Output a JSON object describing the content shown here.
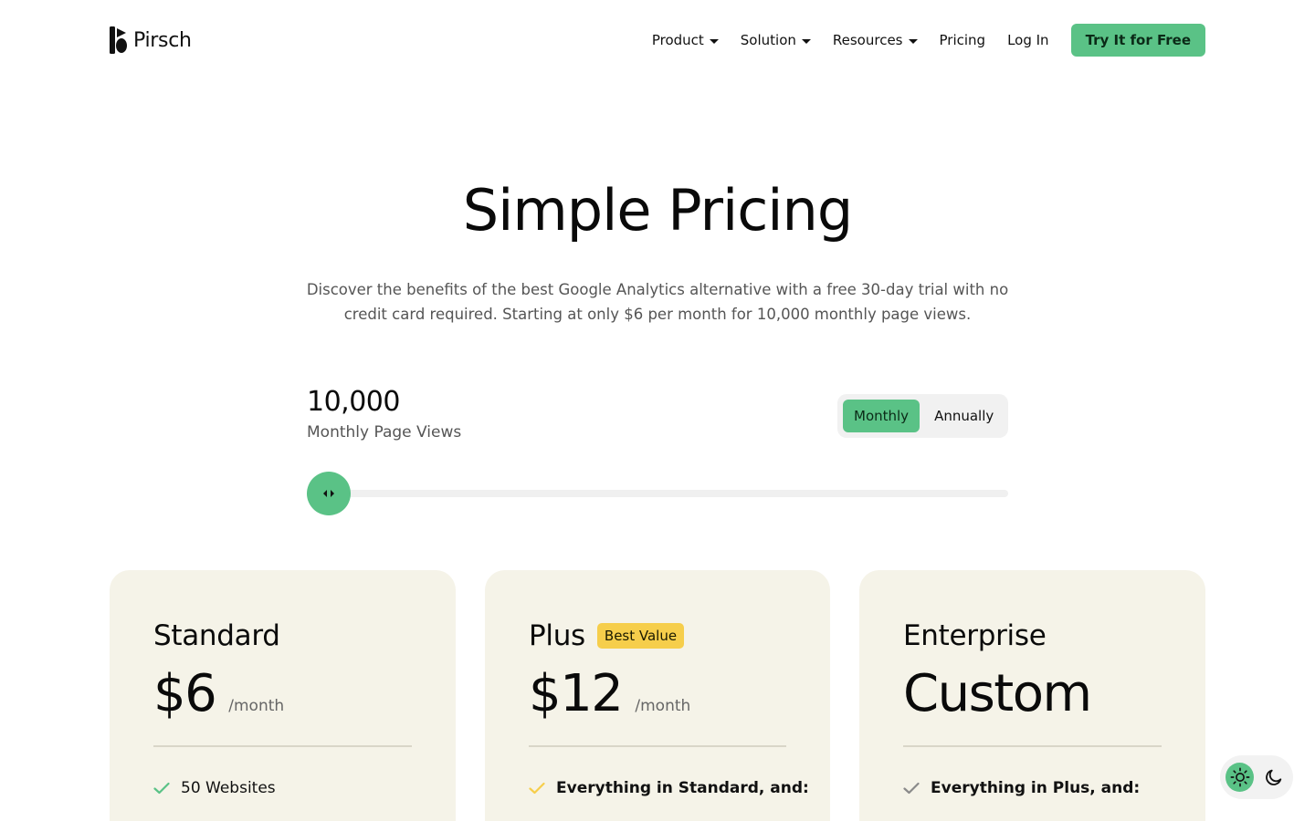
{
  "brand": {
    "name": "Pirsch",
    "accent": "#5ac286",
    "badge_color": "#f6ce4b",
    "card_bg": "#f5f3e8"
  },
  "nav": {
    "items": [
      {
        "label": "Product",
        "dropdown": true
      },
      {
        "label": "Solution",
        "dropdown": true
      },
      {
        "label": "Resources",
        "dropdown": true
      },
      {
        "label": "Pricing",
        "dropdown": false
      },
      {
        "label": "Log In",
        "dropdown": false
      }
    ],
    "cta": "Try It for Free"
  },
  "hero": {
    "title": "Simple Pricing",
    "subtitle": "Discover the benefits of the best Google Analytics alternative with a free 30-day trial with no credit card required. Starting at only $6 per month for 10,000 monthly page views."
  },
  "calculator": {
    "page_views": "10,000",
    "page_views_label": "Monthly Page Views",
    "slider_fraction": 0,
    "billing": {
      "options": [
        "Monthly",
        "Annually"
      ],
      "selected": "Monthly"
    }
  },
  "plans": [
    {
      "name": "Standard",
      "badge": "",
      "price": "$6",
      "period": "/month",
      "first_feature": "50 Websites",
      "check_color": "#5ac286"
    },
    {
      "name": "Plus",
      "badge": "Best Value",
      "price": "$12",
      "period": "/month",
      "first_feature": "Everything in Standard, and:",
      "check_color": "#f6ce4b"
    },
    {
      "name": "Enterprise",
      "badge": "",
      "price": "Custom",
      "period": "",
      "first_feature": "Everything in Plus, and:",
      "check_color": "#8a8a8a"
    }
  ],
  "theme": {
    "options": [
      "light",
      "dark"
    ],
    "selected": "light"
  }
}
